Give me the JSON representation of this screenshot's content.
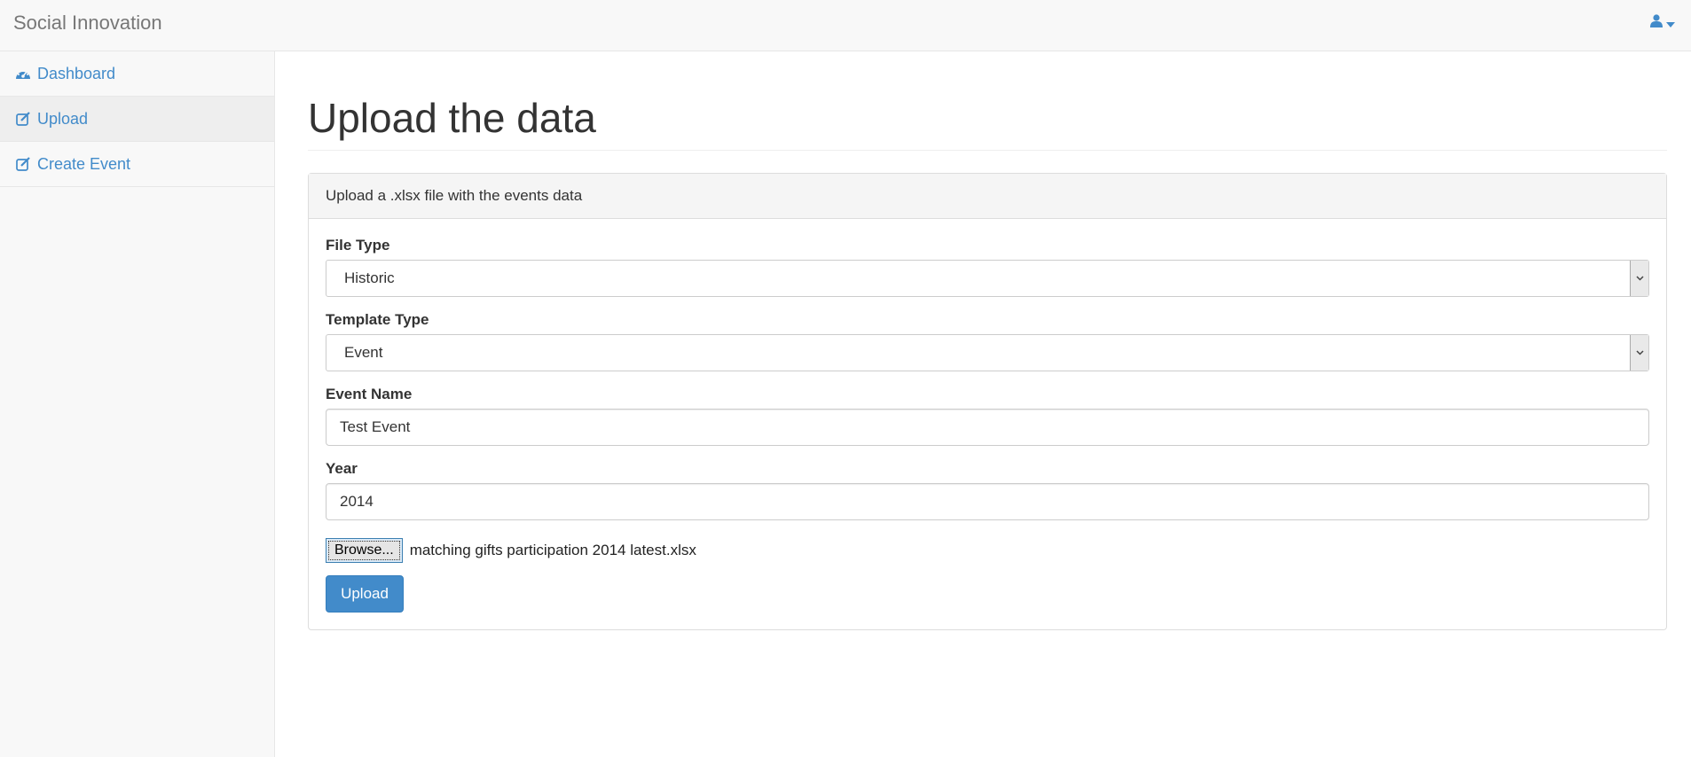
{
  "navbar": {
    "brand": "Social Innovation",
    "user_icon": "user-icon",
    "caret_icon": "caret-down-icon"
  },
  "sidebar": {
    "items": [
      {
        "label": "Dashboard",
        "icon": "dashboard-icon",
        "active": false
      },
      {
        "label": "Upload",
        "icon": "edit-icon",
        "active": true
      },
      {
        "label": "Create Event",
        "icon": "edit-icon",
        "active": false
      }
    ]
  },
  "main": {
    "title": "Upload the data",
    "panel": {
      "heading": "Upload a .xlsx file with the events data",
      "file_type": {
        "label": "File Type",
        "value": "Historic"
      },
      "template_type": {
        "label": "Template Type",
        "value": "Event"
      },
      "event_name": {
        "label": "Event Name",
        "value": "Test Event"
      },
      "year": {
        "label": "Year",
        "value": "2014"
      },
      "file": {
        "browse_label": "Browse...",
        "file_name": "matching gifts participation 2014 latest.xlsx"
      },
      "submit_label": "Upload"
    }
  },
  "colors": {
    "accent": "#428bca",
    "navbar_bg": "#f8f8f8"
  }
}
